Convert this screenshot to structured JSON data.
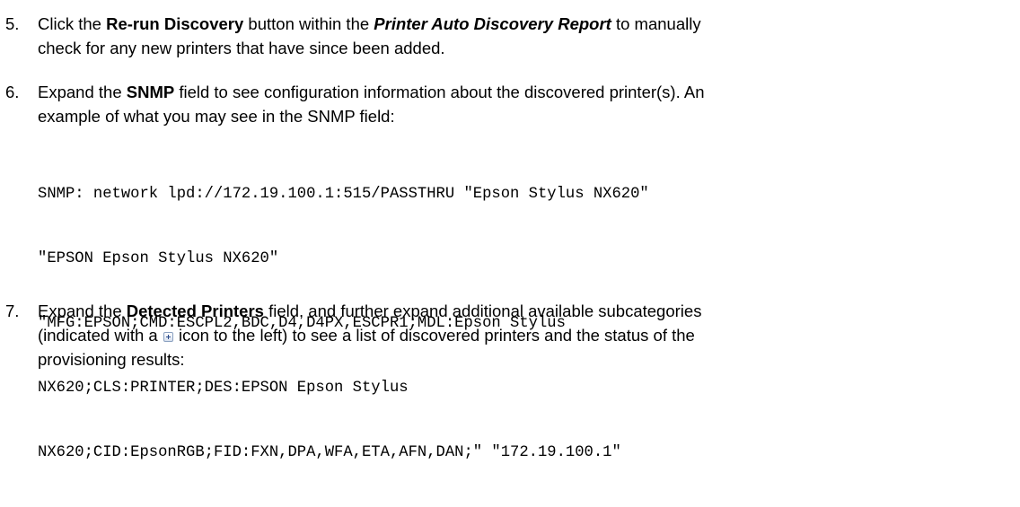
{
  "steps": [
    {
      "number": "5.",
      "t1": "Click the ",
      "b1": "Re-run Discovery",
      "t2": " button within the ",
      "bi1": "Printer Auto Discovery Report",
      "t3": " to manually",
      "line2": "check for any new printers that have since been added."
    },
    {
      "number": "6.",
      "t1": "Expand the ",
      "b1": "SNMP",
      "t2": " field to see configuration information about the discovered printer(s).  An",
      "line2": "example of what you may see in the SNMP field:",
      "code": [
        "SNMP: network lpd://172.19.100.1:515/PASSTHRU \"Epson Stylus NX620\"",
        "\"EPSON Epson Stylus NX620\"",
        "\"MFG:EPSON;CMD:ESCPL2,BDC,D4,D4PX,ESCPR1;MDL:Epson Stylus",
        "NX620;CLS:PRINTER;DES:EPSON Epson Stylus",
        "NX620;CID:EpsonRGB;FID:FXN,DPA,WFA,ETA,AFN,DAN;\" \"172.19.100.1\""
      ]
    },
    {
      "number": "7.",
      "t1": "Expand the ",
      "b1": "Detected Printers",
      "t2": " field, and further expand additional available subcategories",
      "line2a": "(indicated with a ",
      "line2b": " icon to the left) to see a list of discovered printers and the status of the",
      "line3": "provisioning results:",
      "icon": "plus-box-icon"
    }
  ]
}
